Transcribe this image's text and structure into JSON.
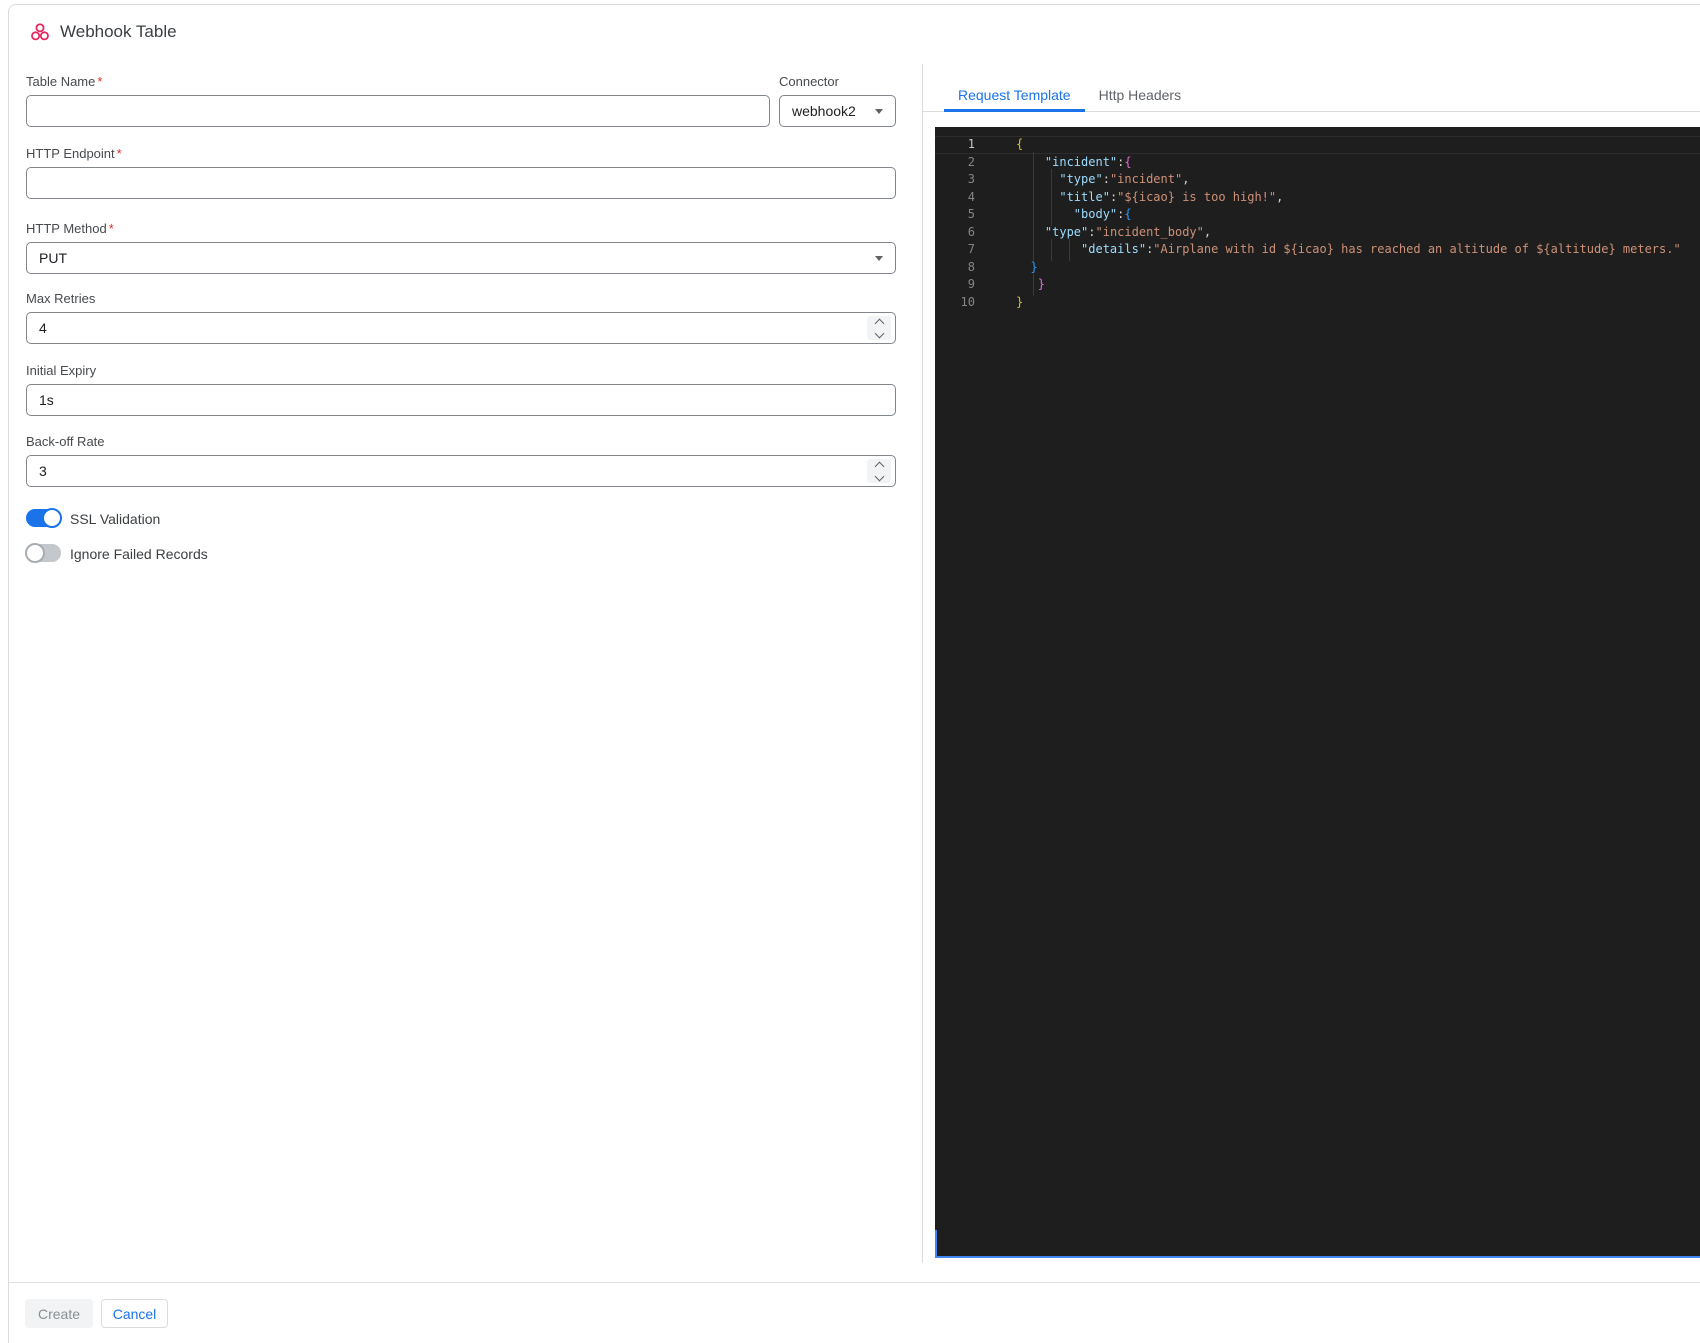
{
  "header": {
    "title": "Webhook Table"
  },
  "required_marker": "*",
  "form": {
    "table_name": {
      "label": "Table Name",
      "value": "",
      "required": true
    },
    "connector": {
      "label": "Connector",
      "value": "webhook2"
    },
    "http_endpoint": {
      "label": "HTTP Endpoint",
      "value": "",
      "required": true
    },
    "http_method": {
      "label": "HTTP Method",
      "value": "PUT",
      "required": true
    },
    "max_retries": {
      "label": "Max Retries",
      "value": "4"
    },
    "initial_expiry": {
      "label": "Initial Expiry",
      "value": "1s"
    },
    "backoff_rate": {
      "label": "Back-off Rate",
      "value": "3"
    },
    "ssl_validation": {
      "label": "SSL Validation",
      "on": true
    },
    "ignore_failed_records": {
      "label": "Ignore Failed Records",
      "on": false
    }
  },
  "tabs": [
    {
      "label": "Request Template",
      "active": true
    },
    {
      "label": "Http Headers",
      "active": false
    }
  ],
  "editor": {
    "colors": {
      "background": "#1e1e1e",
      "key": "#9cdcfe",
      "string": "#ce9178",
      "punct": "#d4d4d4",
      "bracket1": "#d7ba3d",
      "bracket2": "#da70d6",
      "bracket3": "#2e9bff",
      "line_number": "#858585",
      "active_line_number": "#c6c6c6",
      "focus_border": "#4285f4"
    },
    "lines": [
      {
        "n": 1,
        "active": true,
        "guides": [],
        "tokens": [
          [
            "b1",
            "{"
          ]
        ]
      },
      {
        "n": 2,
        "guides": [
          17
        ],
        "tokens": [
          [
            "w",
            "    "
          ],
          [
            "k",
            "\"incident\""
          ],
          [
            "p",
            ":"
          ],
          [
            "b2",
            "{"
          ]
        ]
      },
      {
        "n": 3,
        "guides": [
          17,
          35
        ],
        "tokens": [
          [
            "w",
            "      "
          ],
          [
            "k",
            "\"type\""
          ],
          [
            "p",
            ":"
          ],
          [
            "s",
            "\"incident\""
          ],
          [
            "p",
            ","
          ]
        ]
      },
      {
        "n": 4,
        "guides": [
          17,
          35
        ],
        "tokens": [
          [
            "w",
            "      "
          ],
          [
            "k",
            "\"title\""
          ],
          [
            "p",
            ":"
          ],
          [
            "s",
            "\"${icao} is too high!\""
          ],
          [
            "p",
            ","
          ]
        ]
      },
      {
        "n": 5,
        "guides": [
          17,
          35
        ],
        "tokens": [
          [
            "w",
            "        "
          ],
          [
            "k",
            "\"body\""
          ],
          [
            "p",
            ":"
          ],
          [
            "b3",
            "{"
          ]
        ]
      },
      {
        "n": 6,
        "guides": [
          17
        ],
        "tokens": [
          [
            "w",
            "    "
          ],
          [
            "k",
            "\"type\""
          ],
          [
            "p",
            ":"
          ],
          [
            "s",
            "\"incident_body\""
          ],
          [
            "p",
            ","
          ]
        ]
      },
      {
        "n": 7,
        "guides": [
          17,
          35,
          53
        ],
        "tokens": [
          [
            "w",
            "         "
          ],
          [
            "k",
            "\"details\""
          ],
          [
            "p",
            ":"
          ],
          [
            "s",
            "\"Airplane with id ${icao} has reached an altitude of ${altitude} meters.\""
          ]
        ]
      },
      {
        "n": 8,
        "guides": [],
        "tokens": [
          [
            "w",
            "  "
          ],
          [
            "b3",
            "}"
          ]
        ]
      },
      {
        "n": 9,
        "guides": [
          17
        ],
        "tokens": [
          [
            "w",
            "   "
          ],
          [
            "b2",
            "}"
          ]
        ]
      },
      {
        "n": 10,
        "guides": [],
        "tokens": [
          [
            "b1",
            "}"
          ]
        ]
      }
    ]
  },
  "footer": {
    "create_label": "Create",
    "cancel_label": "Cancel"
  },
  "colors": {
    "accent_blue": "#1a73e8",
    "brand_pink": "#e5245e"
  }
}
